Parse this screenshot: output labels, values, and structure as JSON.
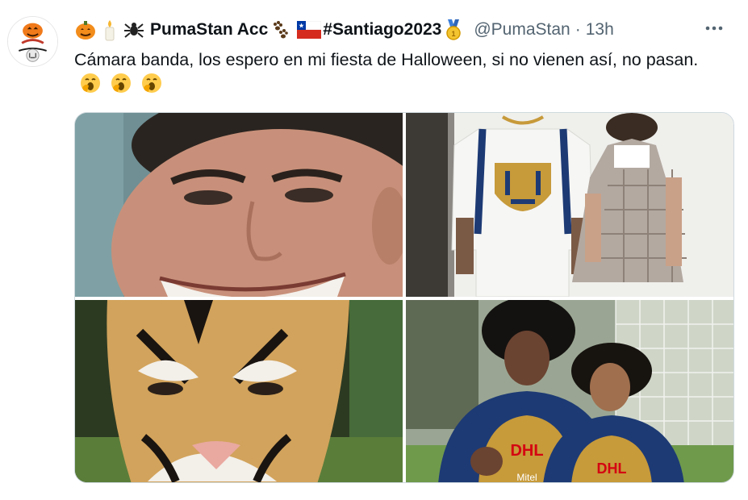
{
  "tweet": {
    "author": {
      "display_name": "PumaStan Acc",
      "hashtag": "#Santiago2023",
      "handle": "@PumaStan",
      "name_emojis": [
        "pumpkin-icon",
        "candle-icon",
        "spider-icon"
      ],
      "after_name_emojis": [
        "paw-prints-icon",
        "chile-flag-icon"
      ],
      "after_hashtag_emoji": "gold-medal-icon"
    },
    "separator": "·",
    "timestamp": "13h",
    "text_line": "Cámara banda, los espero en mi fiesta de Halloween, si no vienen así, no pasan.",
    "text_emojis": [
      "yawning-face-icon",
      "yawning-face-icon",
      "yawning-face-icon"
    ],
    "media": [
      {
        "name": "photo-smiling-man-closeup"
      },
      {
        "name": "photo-couple-pumas-jersey-school-uniform"
      },
      {
        "name": "photo-cat-mask"
      },
      {
        "name": "photo-players-afro-wigs-dhl-jerseys"
      }
    ],
    "media_text": {
      "sponsor": "DHL",
      "sponsor2": "DHL",
      "sponsor3": "Mitel"
    }
  },
  "colors": {
    "text": "#0f1419",
    "secondary": "#536471",
    "border": "#cfd9de",
    "puma_gold": "#c79a3a",
    "puma_navy": "#1d3a74"
  }
}
